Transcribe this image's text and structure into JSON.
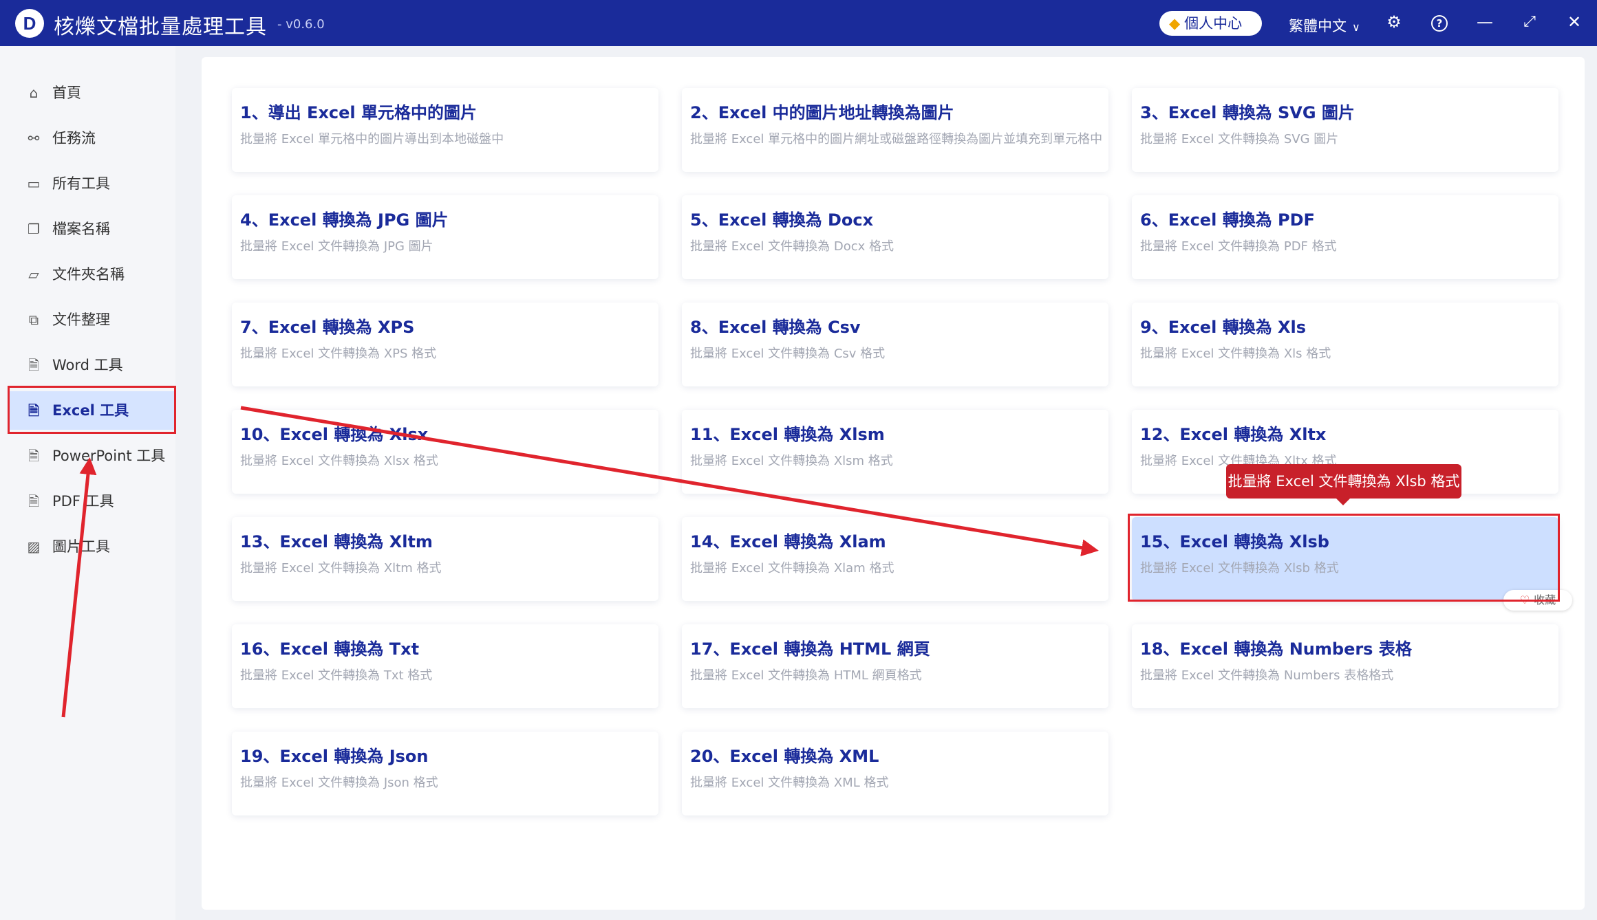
{
  "titlebar": {
    "logo_letter": "D",
    "app_title": "核爍文檔批量處理工具",
    "version": "- v0.6.0",
    "profile_button": "個人中心",
    "language": "繁體中文",
    "icons": [
      "settings-icon",
      "help-icon",
      "minimize-icon",
      "maximize-icon",
      "close-icon"
    ]
  },
  "sidebar": {
    "items": [
      {
        "label": "首頁",
        "icon": "home-icon"
      },
      {
        "label": "任務流",
        "icon": "workflow-icon"
      },
      {
        "label": "所有工具",
        "icon": "monitor-icon"
      },
      {
        "label": "檔案名稱",
        "icon": "file-icon"
      },
      {
        "label": "文件夾名稱",
        "icon": "folder-icon"
      },
      {
        "label": "文件整理",
        "icon": "organize-icon"
      },
      {
        "label": "Word 工具",
        "icon": "word-icon"
      },
      {
        "label": "Excel 工具",
        "icon": "excel-icon"
      },
      {
        "label": "PowerPoint 工具",
        "icon": "ppt-icon"
      },
      {
        "label": "PDF 工具",
        "icon": "pdf-icon"
      },
      {
        "label": "圖片工具",
        "icon": "image-icon"
      }
    ],
    "active_index": 7
  },
  "tools": [
    {
      "title": "1、導出 Excel 單元格中的圖片",
      "desc": "批量將 Excel 單元格中的圖片導出到本地磁盤中"
    },
    {
      "title": "2、Excel 中的圖片地址轉換為圖片",
      "desc": "批量將 Excel 單元格中的圖片網址或磁盤路徑轉換為圖片並填充到單元格中"
    },
    {
      "title": "3、Excel 轉換為 SVG 圖片",
      "desc": "批量將 Excel 文件轉換為 SVG 圖片"
    },
    {
      "title": "4、Excel 轉換為 JPG 圖片",
      "desc": "批量將 Excel 文件轉換為 JPG 圖片"
    },
    {
      "title": "5、Excel 轉換為 Docx",
      "desc": "批量將 Excel 文件轉換為 Docx 格式"
    },
    {
      "title": "6、Excel 轉換為 PDF",
      "desc": "批量將 Excel 文件轉換為 PDF 格式"
    },
    {
      "title": "7、Excel 轉換為 XPS",
      "desc": "批量將 Excel 文件轉換為 XPS 格式"
    },
    {
      "title": "8、Excel 轉換為 Csv",
      "desc": "批量將 Excel 文件轉換為 Csv 格式"
    },
    {
      "title": "9、Excel 轉換為 Xls",
      "desc": "批量將 Excel 文件轉換為 Xls 格式"
    },
    {
      "title": "10、Excel 轉換為 Xlsx",
      "desc": "批量將 Excel 文件轉換為 Xlsx 格式"
    },
    {
      "title": "11、Excel 轉換為 Xlsm",
      "desc": "批量將 Excel 文件轉換為 Xlsm 格式"
    },
    {
      "title": "12、Excel 轉換為 Xltx",
      "desc": "批量將 Excel 文件轉換為 Xltx 格式"
    },
    {
      "title": "13、Excel 轉換為 Xltm",
      "desc": "批量將 Excel 文件轉換為 Xltm 格式"
    },
    {
      "title": "14、Excel 轉換為 Xlam",
      "desc": "批量將 Excel 文件轉換為 Xlam 格式"
    },
    {
      "title": "15、Excel 轉換為 Xlsb",
      "desc": "批量將 Excel 文件轉換為 Xlsb 格式"
    },
    {
      "title": "16、Excel 轉換為 Txt",
      "desc": "批量將 Excel 文件轉換為 Txt 格式"
    },
    {
      "title": "17、Excel 轉換為 HTML 網頁",
      "desc": "批量將 Excel 文件轉換為 HTML 網頁格式"
    },
    {
      "title": "18、Excel 轉換為 Numbers 表格",
      "desc": "批量將 Excel 文件轉換為 Numbers 表格格式"
    },
    {
      "title": "19、Excel 轉換為 Json",
      "desc": "批量將 Excel 文件轉換為 Json 格式"
    },
    {
      "title": "20、Excel 轉換為 XML",
      "desc": "批量將 Excel 文件轉換為 XML 格式"
    }
  ],
  "selected_tool_index": 14,
  "tooltip": "批量將 Excel 文件轉換為 Xlsb 格式",
  "favorite_label": "收藏",
  "colors": {
    "titlebar": "#1a2b9a",
    "accent_text": "#1a2b9a",
    "active_nav_bg": "#d6e4ff",
    "selected_card_bg": "#cddfff",
    "annotation_red": "#e0242d"
  }
}
